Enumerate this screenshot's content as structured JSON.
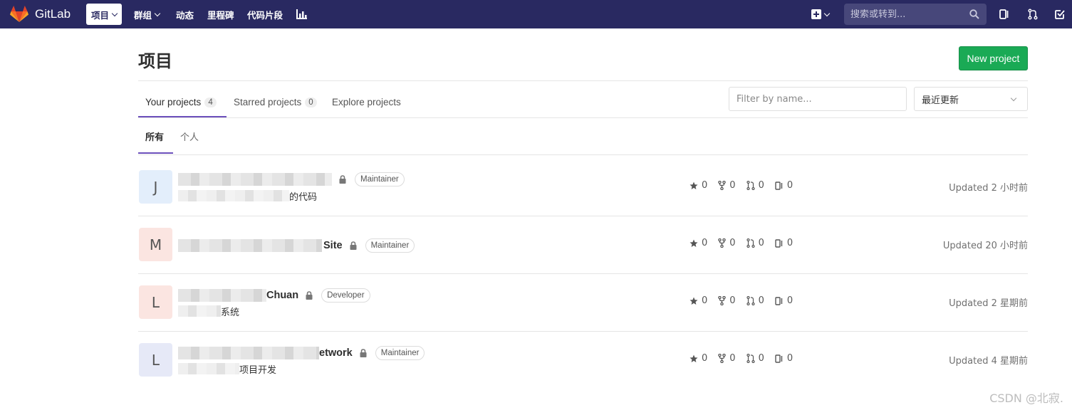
{
  "navbar": {
    "brand": "GitLab",
    "items": [
      {
        "label": "项目",
        "active": true,
        "dropdown": true
      },
      {
        "label": "群组",
        "active": false,
        "dropdown": true
      },
      {
        "label": "动态",
        "active": false
      },
      {
        "label": "里程碑",
        "active": false
      },
      {
        "label": "代码片段",
        "active": false
      }
    ],
    "search_placeholder": "搜索或转到...",
    "icons": [
      "chart-icon",
      "plus-square-icon",
      "search-icon",
      "issues-icon",
      "merge-request-icon",
      "todo-icon"
    ],
    "bg_color": "#292961"
  },
  "page": {
    "title": "项目",
    "new_project_label": "New project",
    "tabs": [
      {
        "label": "Your projects",
        "count": "4",
        "active": true
      },
      {
        "label": "Starred projects",
        "count": "0",
        "active": false
      },
      {
        "label": "Explore projects",
        "active": false
      }
    ],
    "filter_placeholder": "Filter by name...",
    "sort_value": "最近更新",
    "subtabs": [
      {
        "label": "所有",
        "active": true
      },
      {
        "label": "个人",
        "active": false
      }
    ]
  },
  "projects": [
    {
      "avatar": "J",
      "avatar_bg": "#e3eefb",
      "name_visible": "",
      "description_visible": "的代码",
      "role": "Maintainer",
      "stars": "0",
      "forks": "0",
      "merge_requests": "0",
      "issues": "0",
      "updated": "Updated 2 小时前"
    },
    {
      "avatar": "M",
      "avatar_bg": "#fbe5e1",
      "name_visible": "Site",
      "description_visible": "",
      "role": "Maintainer",
      "stars": "0",
      "forks": "0",
      "merge_requests": "0",
      "issues": "0",
      "updated": "Updated 20 小时前"
    },
    {
      "avatar": "L",
      "avatar_bg": "#fbe5e1",
      "name_visible": "Chuan",
      "description_visible": "系统",
      "role": "Developer",
      "stars": "0",
      "forks": "0",
      "merge_requests": "0",
      "issues": "0",
      "updated": "Updated 2 星期前"
    },
    {
      "avatar": "L",
      "avatar_bg": "#e6e9f7",
      "name_visible": "etwork",
      "description_visible": "项目开发",
      "role": "Maintainer",
      "stars": "0",
      "forks": "0",
      "merge_requests": "0",
      "issues": "0",
      "updated": "Updated 4 星期前"
    }
  ],
  "watermark": "CSDN @北寂."
}
